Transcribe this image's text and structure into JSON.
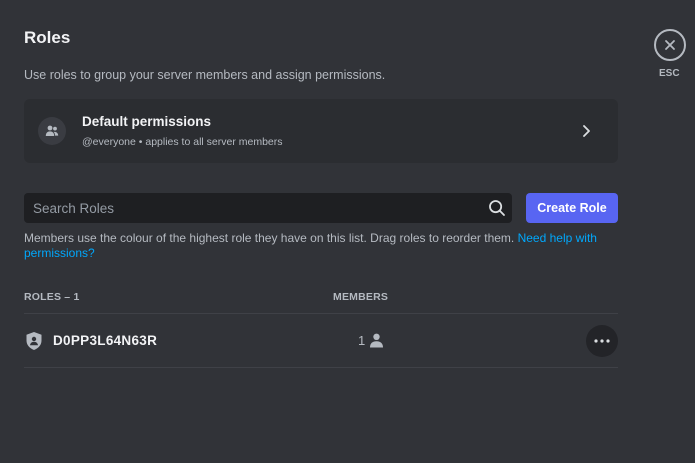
{
  "header": {
    "title": "Roles",
    "subtitle": "Use roles to group your server members and assign permissions."
  },
  "default_permissions": {
    "title": "Default permissions",
    "subtitle": "@everyone • applies to all server members"
  },
  "search": {
    "placeholder": "Search Roles",
    "value": ""
  },
  "create_role": {
    "label": "Create Role"
  },
  "hint": {
    "text": "Members use the colour of the highest role they have on this list. Drag roles to reorder them.",
    "link": "Need help with permissions?"
  },
  "table": {
    "roles_header": "ROLES – 1",
    "members_header": "MEMBERS",
    "rows": [
      {
        "name": "D0PP3L64N63R",
        "members": "1"
      }
    ]
  },
  "close": {
    "label": "ESC"
  },
  "colors": {
    "background": "#313338",
    "card": "#2b2d31",
    "input": "#1e1f22",
    "accent": "#5865f2",
    "link": "#00a8fc"
  },
  "icons": {
    "default_permissions": "members-icon",
    "chevron": "chevron-right-icon",
    "search": "search-icon",
    "role": "shield-icon",
    "members": "person-icon",
    "more": "more-horizontal-icon",
    "close": "close-icon"
  }
}
